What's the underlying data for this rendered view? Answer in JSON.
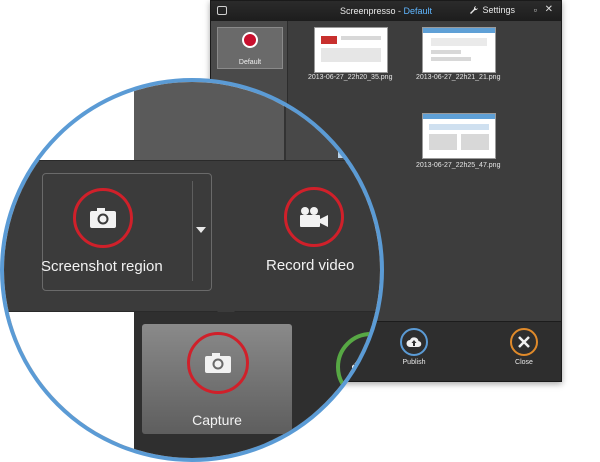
{
  "window": {
    "app_name": "Screenpresso",
    "separator": "-",
    "workspace": "Default",
    "settings_label": "Settings",
    "minimize_glyph": "▫",
    "close_glyph": "✕"
  },
  "sidebar": {
    "workspace_label": "Default"
  },
  "gallery": {
    "items": [
      {
        "filename": "2013-06-27_22h20_35.png"
      },
      {
        "filename": "2013-06-27_22h21_21.png"
      },
      {
        "filename": "2013-06-27_22h25_47.png"
      }
    ]
  },
  "bottombar": {
    "publish_label": "Publish",
    "close_label": "Close"
  },
  "magnifier": {
    "screenshot_region_label": "Screenshot region",
    "record_video_label": "Record video",
    "capture_label": "Capture"
  },
  "colors": {
    "accent_blue": "#5b9bd5",
    "ring_red": "#d0202a",
    "publish_ring": "#5b9bd5",
    "close_ring": "#e08a2a",
    "tool_ring": "#57a844"
  },
  "icons": {
    "app": "app-icon",
    "settings": "wrench-icon",
    "camera": "camera-icon",
    "video": "video-camera-icon",
    "publish": "cloud-upload-icon",
    "close": "close-icon",
    "dropdown": "caret-down-icon"
  }
}
